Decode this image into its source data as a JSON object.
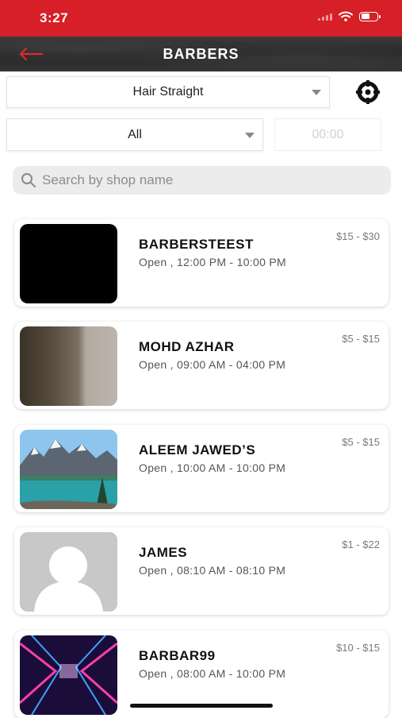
{
  "status_bar": {
    "time": "3:27"
  },
  "nav": {
    "title": "BARBERS",
    "back_icon": "back-arrow-icon"
  },
  "filters": {
    "service": "Hair Straight",
    "category": "All",
    "time": "00:00",
    "location_icon": "locate-icon"
  },
  "search": {
    "placeholder": "Search by shop name"
  },
  "shops": [
    {
      "name": "BARBERSTEEST",
      "hours": "Open , 12:00 PM - 10:00 PM",
      "price": "$15 - $30"
    },
    {
      "name": "MOHD AZHAR",
      "hours": "Open , 09:00 AM - 04:00 PM",
      "price": "$5 - $15"
    },
    {
      "name": "ALEEM JAWED’S",
      "hours": "Open , 10:00 AM - 10:00 PM",
      "price": "$5 - $15"
    },
    {
      "name": "JAMES",
      "hours": "Open , 08:10 AM - 08:10 PM",
      "price": "$1 - $22"
    },
    {
      "name": "BARBAR99",
      "hours": "Open , 08:00 AM - 10:00 PM",
      "price": "$10 - $15"
    }
  ],
  "colors": {
    "status_bar": "#d61f26",
    "back_arrow": "#e0282f"
  }
}
